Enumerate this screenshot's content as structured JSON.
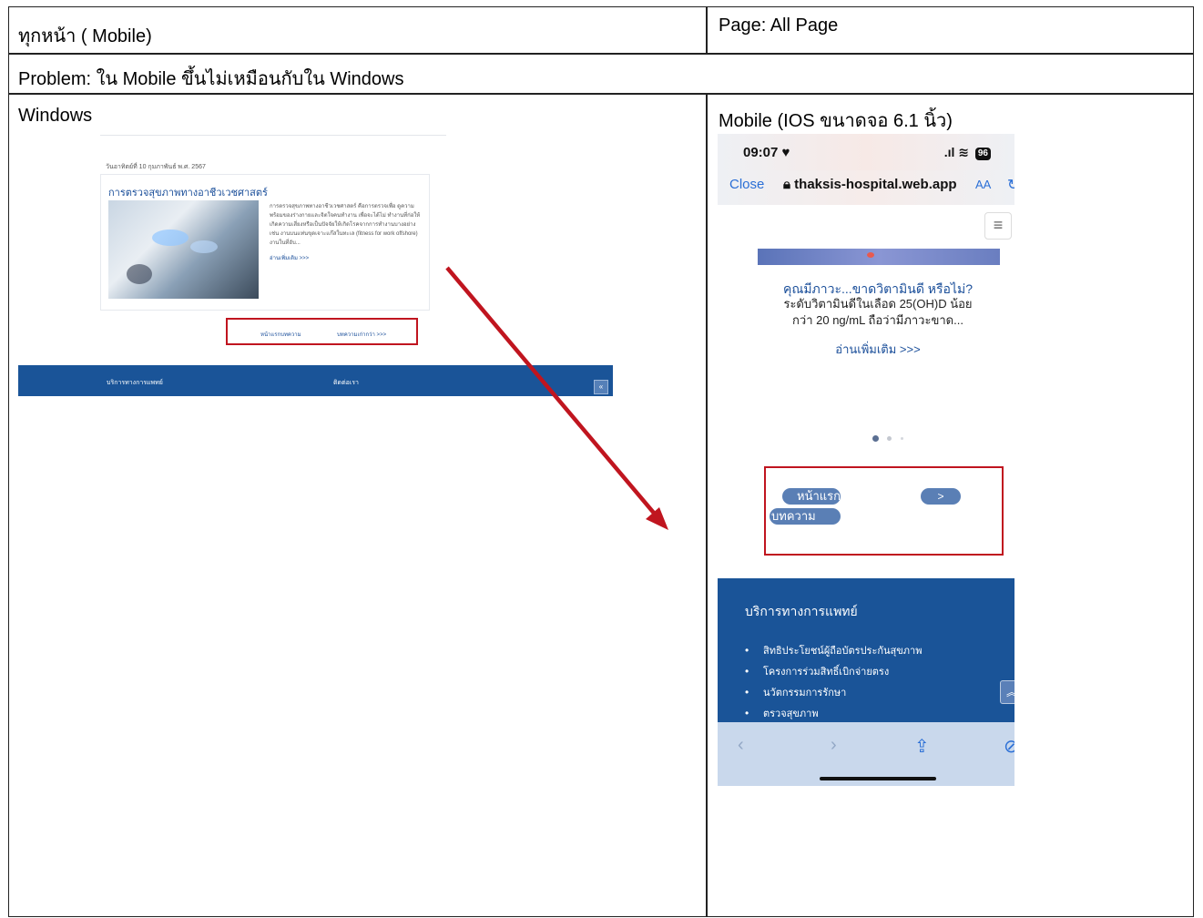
{
  "header": {
    "section_label": "ทุกหน้า  ( Mobile)",
    "page_label": "Page: All Page"
  },
  "problem": {
    "text": "Problem:   ใน Mobile ขึ้นไม่เหมือนกับใน Windows"
  },
  "columns": {
    "left_heading": "Windows",
    "right_heading": "Mobile (IOS ขนาดจอ 6.1 นิ้ว)"
  },
  "windows_screenshot": {
    "date": "วันอาทิตย์ที่ 10 กุมภาพันธ์ พ.ศ. 2567",
    "article_title": "การตรวจสุขภาพทางอาชีวเวชศาสตร์",
    "article_body": "การตรวจสุขภาพทางอาชีวเวชศาสตร์ คือการตรวจเพื่อ ดูความพร้อมของร่างกายและจิตใจคนทำงาน เพื่อจะได้ไม่ ทำงานที่ก่อให้เกิดความเสี่ยงหรือเป็นปัจจัยให้เกิดโรคจากการทำงานบางอย่าง เช่น งานบนแท่นขุดเจาะแก๊สในทะเล (fitness for work offshore) งานในที่อับ...",
    "read_more": "อ่านเพิ่มเติม >>>",
    "pager_first": "หน้าแรกบทความ",
    "pager_older": "บทความเก่ากว่า >>>",
    "footer_left": "บริการทางการแพทย์",
    "footer_right": "ติดต่อเรา",
    "scroll_top_icon": "chevron-up-double-icon"
  },
  "mobile_screenshot": {
    "status_time": "09:07",
    "battery": "96",
    "close_label": "Close",
    "url": "thaksis-hospital.web.app",
    "text_size_label": "AA",
    "article_title": "คุณมีภาวะ...ขาดวิตามินดี หรือไม่?",
    "article_line_1": "ระดับวิตามินดีในเลือด 25(OH)D น้อย",
    "article_line_2": "กว่า 20 ng/mL ถือว่ามีภาวะขาด...",
    "read_more": "อ่านเพิ่มเติม >>>",
    "pager_first_line1": "หน้าแรก",
    "pager_first_line2": "บทความ",
    "pager_next": ">",
    "footer_title": "บริการทางการแพทย์",
    "footer_items": [
      "สิทธิประโยชน์ผู้ถือบัตรประกันสุขภาพ",
      "โครงการร่วมสิทธิ์เบิกจ่ายตรง",
      "นวัตกรรมการรักษา",
      "ตรวจสุขภาพ"
    ]
  },
  "colors": {
    "highlight_red": "#c0151f",
    "footer_blue": "#1a5498",
    "link_blue": "#1b4f9a",
    "ios_blue": "#2b6fd6"
  }
}
